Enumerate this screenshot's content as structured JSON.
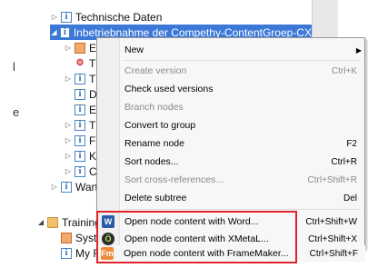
{
  "tree": {
    "rows": [
      {
        "label": "Technische Daten"
      },
      {
        "label": "Inbetriebnahme der Compethy-ContentGroep-CX"
      },
      {
        "label": "E"
      },
      {
        "label": "T"
      },
      {
        "label": "T"
      },
      {
        "label": "D"
      },
      {
        "label": "E"
      },
      {
        "label": "T"
      },
      {
        "label": "F"
      },
      {
        "label": "K"
      },
      {
        "label": "C"
      },
      {
        "label": "Wartung"
      },
      {
        "label": "Training"
      },
      {
        "label": "System"
      },
      {
        "label": "My Firs"
      }
    ],
    "left_chars": [
      "l",
      "e"
    ]
  },
  "menu": {
    "items": [
      {
        "label": "New",
        "shortcut": "",
        "disabled": false,
        "submenu": true
      },
      {
        "label": "Create version",
        "shortcut": "Ctrl+K",
        "disabled": true
      },
      {
        "label": "Check used versions",
        "shortcut": "",
        "disabled": false
      },
      {
        "label": "Branch nodes",
        "shortcut": "",
        "disabled": true
      },
      {
        "label": "Convert to group",
        "shortcut": "",
        "disabled": false
      },
      {
        "label": "Rename node",
        "shortcut": "F2",
        "disabled": false
      },
      {
        "label": "Sort nodes...",
        "shortcut": "Ctrl+R",
        "disabled": false
      },
      {
        "label": "Sort cross-references...",
        "shortcut": "Ctrl+Shift+R",
        "disabled": true
      },
      {
        "label": "Delete subtree",
        "shortcut": "Del",
        "disabled": false
      },
      {
        "label": "Open node content with Word...",
        "shortcut": "Ctrl+Shift+W",
        "disabled": false,
        "icon": "word-icon",
        "icon_glyph": "W"
      },
      {
        "label": "Open node content with XMetaL...",
        "shortcut": "Ctrl+Shift+X",
        "disabled": false,
        "icon": "xmetal-icon",
        "icon_glyph": "Ö"
      },
      {
        "label": "Open node content with FrameMaker...",
        "shortcut": "Ctrl+Shift+F",
        "disabled": false,
        "icon": "framemaker-icon",
        "icon_glyph": "Fm"
      }
    ]
  },
  "colors": {
    "selection": "#3b78d8",
    "highlight_border": "#e0242b"
  }
}
